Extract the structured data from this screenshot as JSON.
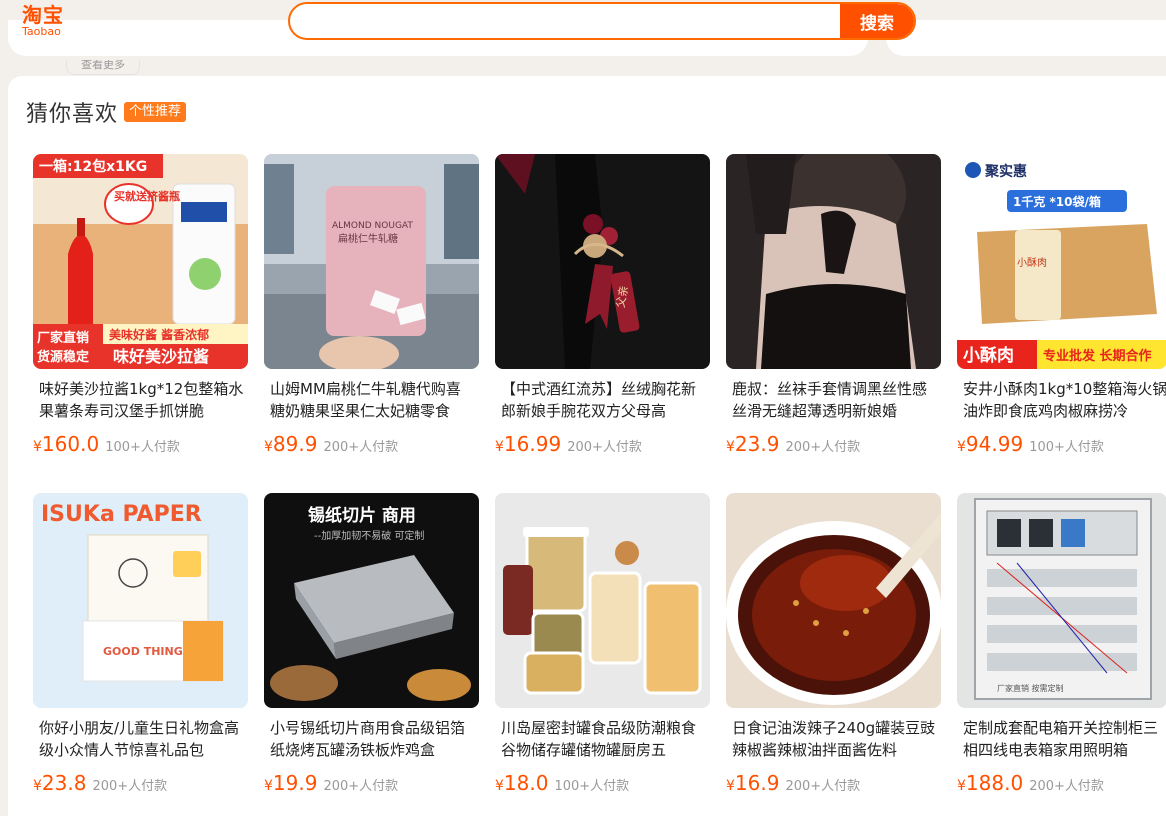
{
  "header": {
    "logo_cn": "淘宝",
    "logo_en": "Taobao",
    "search_value": "",
    "search_button": "搜索",
    "view_more": "查看更多"
  },
  "recommend": {
    "title": "猜你喜欢",
    "badge": "个性推荐"
  },
  "currency": "¥",
  "products": [
    {
      "title": "味好美沙拉酱1kg*12包整箱水果薯条寿司汉堡手抓饼脆",
      "price": "160.0",
      "sold": "100+人付款"
    },
    {
      "title": "山姆MM扁桃仁牛轧糖代购喜糖奶糖果坚果仁太妃糖零食",
      "price": "89.9",
      "sold": "200+人付款"
    },
    {
      "title": "【中式酒红流苏】丝绒胸花新郎新娘手腕花双方父母高",
      "price": "16.99",
      "sold": "200+人付款"
    },
    {
      "title": "鹿叔：丝袜手套情调黑丝性感丝滑无缝超薄透明新娘婚",
      "price": "23.9",
      "sold": "200+人付款"
    },
    {
      "title": "安井小酥肉1kg*10整箱海火锅油炸即食底鸡肉椒麻捞冷",
      "price": "94.99",
      "sold": "100+人付款"
    },
    {
      "title": "你好小朋友/儿童生日礼物盒高级小众情人节惊喜礼品包",
      "price": "23.8",
      "sold": "200+人付款"
    },
    {
      "title": "小号锡纸切片商用食品级铝箔纸烧烤瓦罐汤铁板炸鸡盒",
      "price": "19.9",
      "sold": "200+人付款"
    },
    {
      "title": "川岛屋密封罐食品级防潮粮食谷物储存罐储物罐厨房五",
      "price": "18.0",
      "sold": "100+人付款"
    },
    {
      "title": "日食记油泼辣子240g罐装豆豉辣椒酱辣椒油拌面酱佐料",
      "price": "16.9",
      "sold": "200+人付款"
    },
    {
      "title": "定制成套配电箱开关控制柜三相四线电表箱家用照明箱",
      "price": "188.0",
      "sold": "200+人付款"
    }
  ],
  "image_text": {
    "p1_banner": "一箱:12包x1KG",
    "p1_promo": "买就送挤酱瓶",
    "p1_factory": "厂家直销",
    "p1_source": "货源稳定",
    "p1_tagline": "美味好酱 酱香浓郁",
    "p1_slogan": "味好美沙拉酱",
    "p2_bag": "ALMOND NOUGAT",
    "p2_bag_cn": "扁桃仁牛轧糖",
    "p3_tag": "父亲",
    "p5_brand": "聚实惠",
    "p5_box": "1千克 *10袋/箱",
    "p5_product": "小酥肉",
    "p5_slogan": "专业批发 长期合作",
    "p6_brand": "ISUKa PAPER",
    "p6_card": "GOOD THING",
    "p7_title": "锡纸切片 商用",
    "p7_sub": "--加厚加韧不易破 可定制",
    "p10_caption": "厂家直销 按需定制"
  }
}
